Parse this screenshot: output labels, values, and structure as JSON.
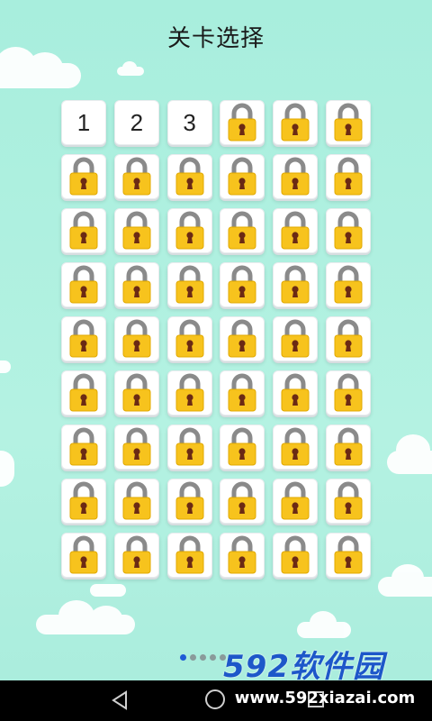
{
  "header": {
    "title": "关卡选择"
  },
  "levels": {
    "unlocked": [
      "1",
      "2",
      "3"
    ],
    "rows": 9,
    "columns": 6,
    "total": 54,
    "locked_icon": "padlock-icon"
  },
  "pager": {
    "pages": 5,
    "current": 1
  },
  "watermark": {
    "brand": "592软件园",
    "url": "www.592xiazai.com"
  },
  "navbar": {
    "back_icon": "back-triangle-icon",
    "home_icon": "home-circle-icon",
    "recent_icon": "recent-square-icon"
  },
  "colors": {
    "background": "#aeeede",
    "lock_body": "#f7c31d",
    "lock_shackle": "#8a8a8a",
    "keyhole": "#6b2a14",
    "active_dot": "#1f5bd6"
  }
}
